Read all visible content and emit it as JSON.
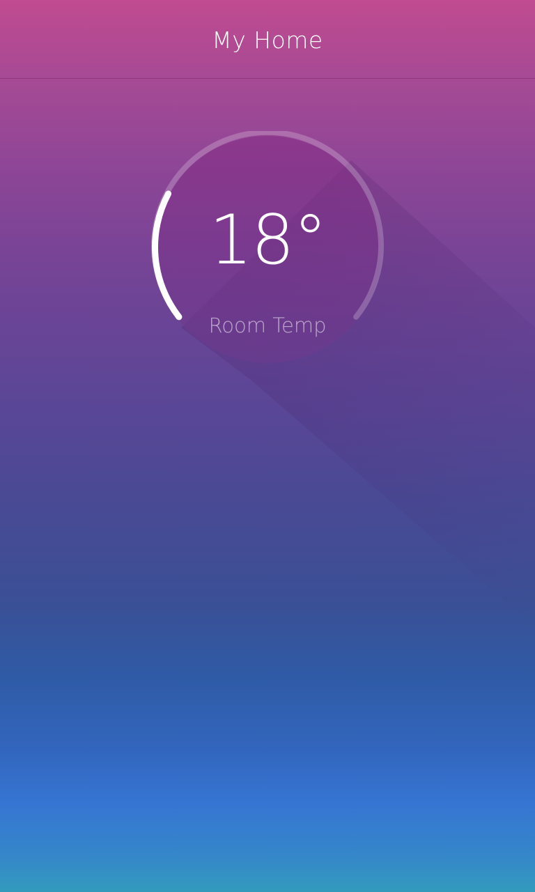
{
  "header": {
    "title": "My Home"
  },
  "thermostat": {
    "temperature": "18°",
    "label": "Room Temp",
    "level_fraction": 0.18
  },
  "colors": {
    "gradient_top": "#c04b90",
    "gradient_mid": "#5b4696",
    "gradient_bottom": "#339bbd",
    "dial_fill": "#7e2f86",
    "arc_active": "#ffffff",
    "arc_track": "rgba(255,255,255,0.25)"
  }
}
